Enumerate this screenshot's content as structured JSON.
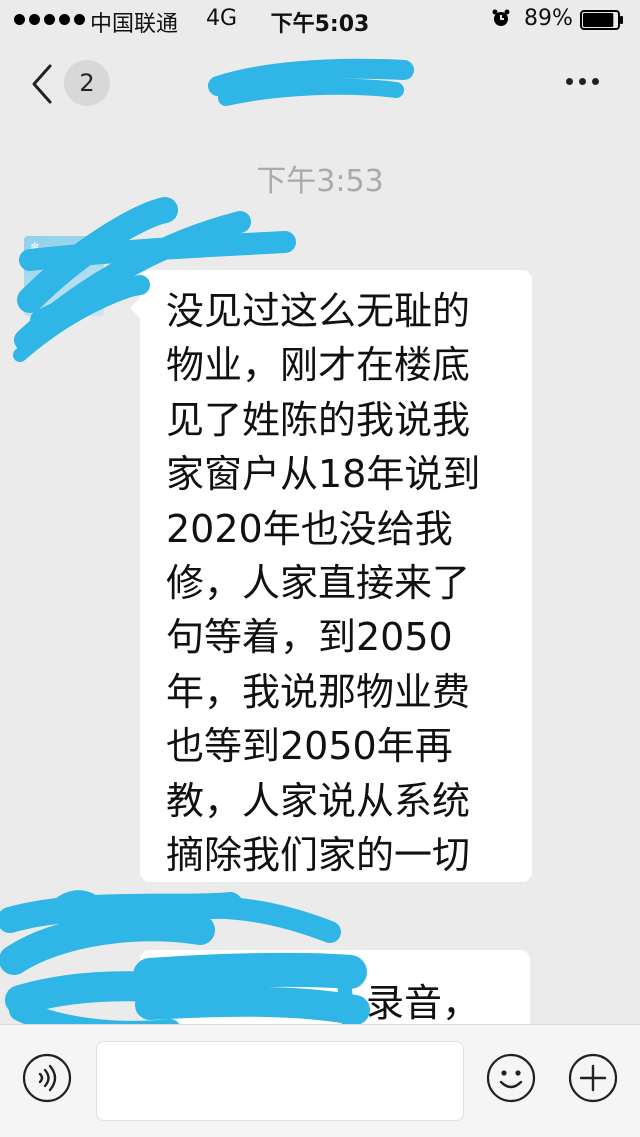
{
  "status_bar": {
    "carrier": "中国联通",
    "network": "4G",
    "time": "下午5:03",
    "battery_percent": "89%",
    "battery_level": 0.89,
    "icons": [
      "signal-dots-icon",
      "alarm-icon",
      "battery-icon"
    ]
  },
  "nav": {
    "back_icon": "chevron-left-icon",
    "unread_count": "2",
    "title": "",
    "more_icon": "more-horizontal-icon"
  },
  "chat": {
    "timestamp": "下午3:53",
    "messages": [
      {
        "sender": "other",
        "lines": [
          "没见过这么无耻的",
          "物业，刚才在楼底",
          "见了姓陈的我说我",
          "家窗户从18年说到",
          "2020年也没给我",
          "修，人家直接来了",
          "句等着，到2050",
          "年，我说那物业费",
          "也等到2050年再",
          "教，人家说从系统",
          "摘除我们家的一切"
        ]
      },
      {
        "sender": "other",
        "text": "录音，"
      }
    ]
  },
  "input_bar": {
    "voice_icon": "voice-icon",
    "placeholder": "",
    "emoji_icon": "emoji-icon",
    "plus_icon": "plus-circle-icon"
  },
  "colors": {
    "background": "#ebebeb",
    "bubble": "#ffffff",
    "redaction": "#2fb5e6",
    "timestamp": "#aaaaaa"
  }
}
